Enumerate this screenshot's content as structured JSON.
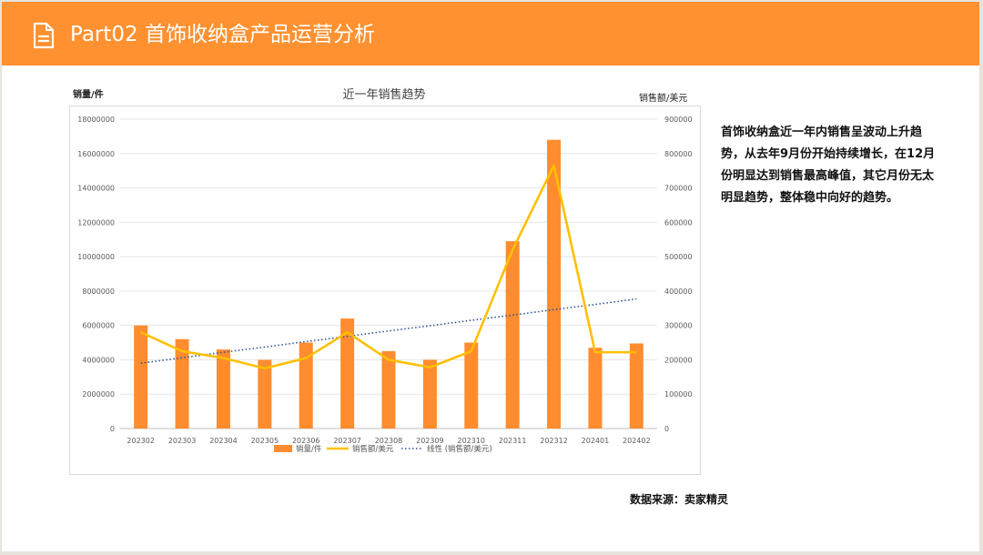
{
  "header": {
    "title": "Part02 首饰收纳盒产品运营分析",
    "icon": "document-icon",
    "color": "#ff9130"
  },
  "note": "首饰收纳盒近一年内销售呈波动上升趋势，从去年9月份开始持续增长，在12月份明显达到销售最高峰值，其它月份无太明显趋势，整体稳中向好的趋势。",
  "source": "数据来源：卖家精灵",
  "chart_data": {
    "type": "bar",
    "title": "近一年销售趋势",
    "ylabel_left": "销量/件",
    "ylabel_right": "销售额/美元",
    "categories": [
      "202302",
      "202303",
      "202304",
      "202305",
      "202306",
      "202307",
      "202308",
      "202309",
      "202310",
      "202311",
      "202312",
      "202401",
      "202402"
    ],
    "y_left_ticks": [
      "0",
      "2000000",
      "4000000",
      "6000000",
      "8000000",
      "10000000",
      "12000000",
      "14000000",
      "16000000",
      "18000000"
    ],
    "y_right_ticks": [
      "0",
      "100000",
      "200000",
      "300000",
      "400000",
      "500000",
      "600000",
      "700000",
      "800000",
      "900000"
    ],
    "ylim_left": [
      0,
      18000000
    ],
    "ylim_right": [
      0,
      900000
    ],
    "grid": true,
    "legend_position": "bottom",
    "series": [
      {
        "name": "销量/件",
        "type": "bar",
        "axis": "left",
        "color": "#ff8c2e",
        "values": [
          6000000,
          5200000,
          4600000,
          4000000,
          5000000,
          6400000,
          4500000,
          4000000,
          5000000,
          10900000,
          16800000,
          4700000,
          4950000
        ]
      },
      {
        "name": "销售额/美元",
        "type": "line",
        "axis": "right",
        "color": "#ffc000",
        "values": [
          280000,
          225000,
          205000,
          175000,
          205000,
          280000,
          200000,
          178000,
          225000,
          520000,
          765000,
          222000,
          222000
        ]
      },
      {
        "name": "线性 (销售额/美元)",
        "type": "trendline",
        "axis": "right",
        "color": "#2f5597",
        "values": [
          190000,
          206000,
          222000,
          237000,
          253000,
          268000,
          284000,
          299000,
          315000,
          330000,
          346000,
          361000,
          377000
        ]
      }
    ]
  }
}
